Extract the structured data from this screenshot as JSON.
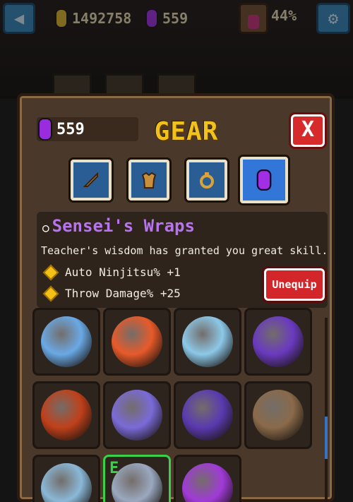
{
  "topbar": {
    "gold": "1492758",
    "gems": "559",
    "potion_percent": "44%",
    "back_icon": "back-arrow-icon",
    "settings_icon": "gear-icon"
  },
  "panel": {
    "gem_count": "559",
    "title": "GEAR",
    "close_label": "X",
    "tabs": [
      {
        "icon": "sword-icon",
        "active": false
      },
      {
        "icon": "armor-icon",
        "active": false
      },
      {
        "icon": "ring-icon",
        "active": false
      },
      {
        "icon": "gem-icon",
        "active": true
      }
    ],
    "selected_item": {
      "name": "Sensei's Wraps",
      "description": "Teacher's wisdom has granted you great skill.",
      "stats": [
        "Auto Ninjitsu% +1",
        "Throw Damage% +25"
      ],
      "action_label": "Unequip"
    },
    "grid_items": [
      {
        "icon": "pearl-ring-icon",
        "color": "#6aa9e6",
        "equipped": false
      },
      {
        "icon": "flame-amulet-icon",
        "color": "#e85a2a",
        "equipped": false
      },
      {
        "icon": "crystal-shield-icon",
        "color": "#8cc8e8",
        "equipped": false
      },
      {
        "icon": "potion-jar-icon",
        "color": "#6a3ac0",
        "equipped": false
      },
      {
        "icon": "fire-heart-icon",
        "color": "#c0401a",
        "equipped": false
      },
      {
        "icon": "moon-crown-icon",
        "color": "#7a6ad8",
        "equipped": false
      },
      {
        "icon": "moon-ribbon-icon",
        "color": "#5a3ab0",
        "equipped": false
      },
      {
        "icon": "winged-staff-icon",
        "color": "#8a6a4a",
        "equipped": false
      },
      {
        "icon": "winged-helmet-icon",
        "color": "#8ab8d8",
        "equipped": false
      },
      {
        "icon": "wraps-icon",
        "color": "#9aa8c0",
        "equipped": true,
        "badge": "E"
      },
      {
        "icon": "spirit-heart-icon",
        "color": "#a03ad8",
        "equipped": false
      }
    ]
  }
}
